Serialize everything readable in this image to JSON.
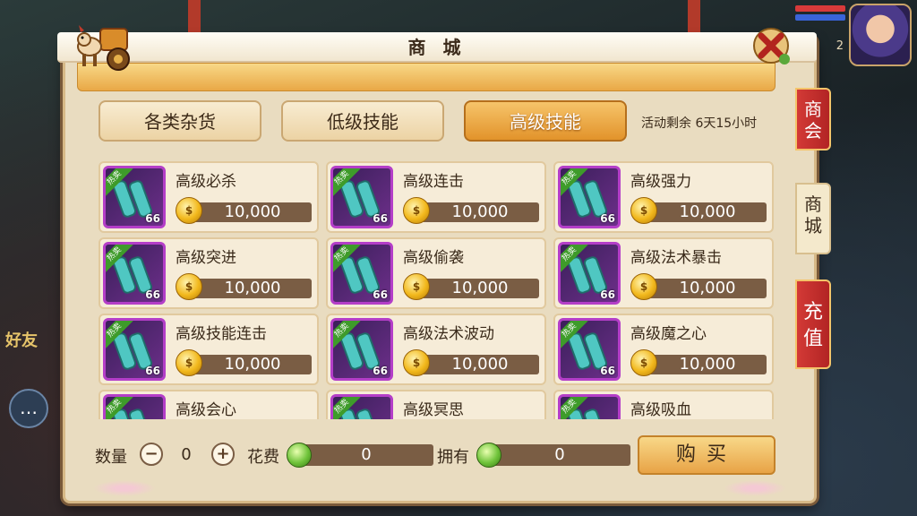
{
  "window": {
    "title": "商 城"
  },
  "tabs": [
    {
      "label": "各类杂货",
      "active": false
    },
    {
      "label": "低级技能",
      "active": false
    },
    {
      "label": "高级技能",
      "active": true
    }
  ],
  "event": {
    "text": "活动剩余 6天15小时"
  },
  "items": [
    {
      "name": "高级必杀",
      "price": "10,000",
      "level": "66",
      "badge": "热卖"
    },
    {
      "name": "高级连击",
      "price": "10,000",
      "level": "66",
      "badge": "热卖"
    },
    {
      "name": "高级强力",
      "price": "10,000",
      "level": "66",
      "badge": "热卖"
    },
    {
      "name": "高级突进",
      "price": "10,000",
      "level": "66",
      "badge": "热卖"
    },
    {
      "name": "高级偷袭",
      "price": "10,000",
      "level": "66",
      "badge": "热卖"
    },
    {
      "name": "高级法术暴击",
      "price": "10,000",
      "level": "66",
      "badge": "热卖"
    },
    {
      "name": "高级技能连击",
      "price": "10,000",
      "level": "66",
      "badge": "热卖"
    },
    {
      "name": "高级法术波动",
      "price": "10,000",
      "level": "66",
      "badge": "热卖"
    },
    {
      "name": "高级魔之心",
      "price": "10,000",
      "level": "66",
      "badge": "热卖"
    },
    {
      "name": "高级会心",
      "price": "",
      "level": "",
      "badge": "热卖"
    },
    {
      "name": "高级冥思",
      "price": "",
      "level": "",
      "badge": "热卖"
    },
    {
      "name": "高级吸血",
      "price": "",
      "level": "",
      "badge": "热卖"
    }
  ],
  "purchase": {
    "quantity_label": "数量",
    "quantity_value": "0",
    "minus": "−",
    "plus": "+",
    "cost_label": "花费",
    "cost_value": "0",
    "owned_label": "拥有",
    "owned_value": "0",
    "buy_label": "购买"
  },
  "side_tabs": [
    {
      "label": "商会",
      "style": "red"
    },
    {
      "label": "商城",
      "style": "cream"
    },
    {
      "label": "充值",
      "style": "red"
    }
  ],
  "background": {
    "friend_label": "好友",
    "chat_icon": "chat-bubble-icon",
    "level": "2"
  },
  "colors": {
    "active_tab": "#e2932b",
    "panel": "#e9dcc0",
    "price_bar": "#7a5d44",
    "side_red": "#c02a28"
  }
}
